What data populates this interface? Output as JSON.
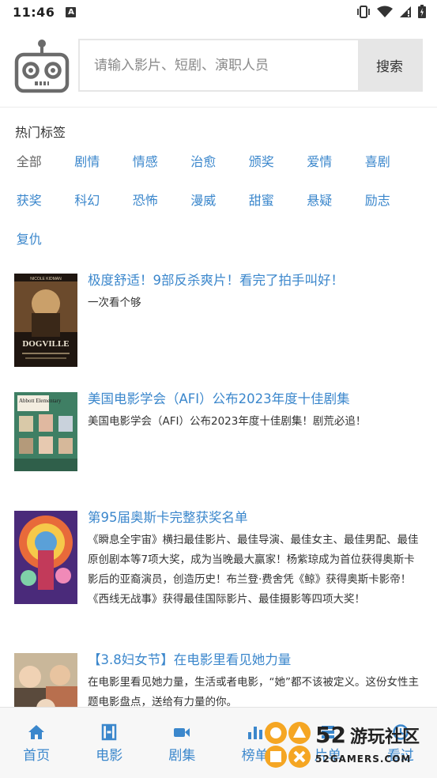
{
  "status_bar": {
    "time": "11:46",
    "notification_badge": "A"
  },
  "search": {
    "placeholder": "请输入影片、短剧、演职人员",
    "button_label": "搜索"
  },
  "tags_section": {
    "title": "热门标签",
    "tags": [
      "全部",
      "剧情",
      "情感",
      "治愈",
      "颁奖",
      "爱情",
      "喜剧",
      "获奖",
      "科幻",
      "恐怖",
      "漫威",
      "甜蜜",
      "悬疑",
      "励志",
      "复仇"
    ]
  },
  "articles": [
    {
      "title": "极度舒适！9部反杀爽片！看完了拍手叫好！",
      "description": "一次看个够",
      "poster_text": "DOGVILLE",
      "poster_top_text": "NICOLE KIDMAN"
    },
    {
      "title": "美国电影学会（AFI）公布2023年度十佳剧集",
      "description": "美国电影学会（AFI）公布2023年度十佳剧集！剧荒必追！",
      "poster_text": "Abbott Elementary"
    },
    {
      "title": "第95届奥斯卡完整获奖名单",
      "description": "《瞬息全宇宙》横扫最佳影片、最佳导演、最佳女主、最佳男配、最佳原创剧本等7项大奖，成为当晚最大赢家！杨紫琼成为首位获得奥斯卡影后的亚裔演员，创造历史！布兰登·费舍凭《鲸》获得奥斯卡影帝！《西线无战事》获得最佳国际影片、最佳摄影等四项大奖！"
    },
    {
      "title": "【3.8妇女节】在电影里看见她力量",
      "description": "在电影里看见她力量，生活或者电影，“她”都不该被定义。这份女性主题电影盘点，送给有力量的你。"
    }
  ],
  "bottom_nav": [
    "首页",
    "电影",
    "剧集",
    "榜单",
    "片单",
    "看过"
  ],
  "watermark": {
    "number": "52",
    "text": "游玩社区",
    "domain": "52GAMERS.COM"
  },
  "colors": {
    "accent": "#3b87cc",
    "watermark_orange": "#f5a623"
  }
}
